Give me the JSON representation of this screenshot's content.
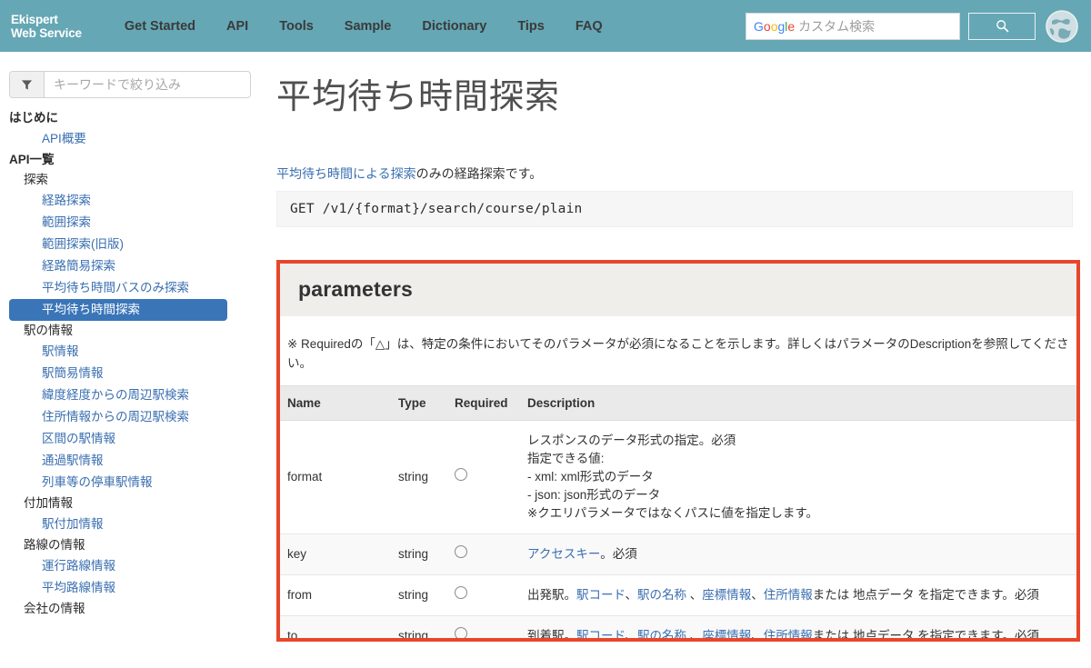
{
  "header": {
    "brand_line1": "Ekispert",
    "brand_line2": "Web Service",
    "nav": [
      {
        "label": "Get Started"
      },
      {
        "label": "API"
      },
      {
        "label": "Tools"
      },
      {
        "label": "Sample"
      },
      {
        "label": "Dictionary"
      },
      {
        "label": "Tips"
      },
      {
        "label": "FAQ"
      }
    ],
    "search": {
      "placeholder_brand": "Google",
      "placeholder_text": " カスタム検索",
      "value": "",
      "button_icon": "search-icon"
    },
    "globe_icon": "globe-icon",
    "background_color": "#65a7b5"
  },
  "sidebar": {
    "filter": {
      "icon": "filter-icon",
      "placeholder": "キーワードで絞り込み",
      "value": ""
    },
    "tree": [
      {
        "type": "h1",
        "label": "はじめに"
      },
      {
        "type": "link",
        "label": "API概要",
        "active": false
      },
      {
        "type": "h1",
        "label": "API一覧"
      },
      {
        "type": "h2",
        "label": "探索"
      },
      {
        "type": "link",
        "label": "経路探索",
        "active": false
      },
      {
        "type": "link",
        "label": "範囲探索",
        "active": false
      },
      {
        "type": "link",
        "label": "範囲探索(旧版)",
        "active": false
      },
      {
        "type": "link",
        "label": "経路簡易探索",
        "active": false
      },
      {
        "type": "link",
        "label": "平均待ち時間バスのみ探索",
        "active": false
      },
      {
        "type": "link",
        "label": "平均待ち時間探索",
        "active": true
      },
      {
        "type": "h2",
        "label": "駅の情報"
      },
      {
        "type": "link",
        "label": "駅情報",
        "active": false
      },
      {
        "type": "link",
        "label": "駅簡易情報",
        "active": false
      },
      {
        "type": "link",
        "label": "緯度経度からの周辺駅検索",
        "active": false
      },
      {
        "type": "link",
        "label": "住所情報からの周辺駅検索",
        "active": false
      },
      {
        "type": "link",
        "label": "区間の駅情報",
        "active": false
      },
      {
        "type": "link",
        "label": "通過駅情報",
        "active": false
      },
      {
        "type": "link",
        "label": "列車等の停車駅情報",
        "active": false
      },
      {
        "type": "h2",
        "label": "付加情報"
      },
      {
        "type": "link",
        "label": "駅付加情報",
        "active": false
      },
      {
        "type": "h2",
        "label": "路線の情報"
      },
      {
        "type": "link",
        "label": "運行路線情報",
        "active": false
      },
      {
        "type": "link",
        "label": "平均路線情報",
        "active": false
      },
      {
        "type": "h2",
        "label": "会社の情報"
      }
    ],
    "active_bg_color": "#3a75b8",
    "link_color": "#3a6fb0"
  },
  "main": {
    "title": "平均待ち時間探索",
    "intro_link": "平均待ち時間による探索",
    "intro_rest": "のみの経路探索です。",
    "endpoint": "GET /v1/{format}/search/course/plain",
    "panel": {
      "heading": "parameters",
      "note": "※ Requiredの「△」は、特定の条件においてそのパラメータが必須になることを示します。詳しくはパラメータのDescriptionを参照してください。",
      "highlight_color": "#e8462a",
      "columns": [
        "Name",
        "Type",
        "Required",
        "Description"
      ],
      "rows": [
        {
          "name": "format",
          "type": "string",
          "required": "○",
          "desc_lines": [
            "レスポンスのデータ形式の指定。必須",
            "指定できる値:",
            "- xml: xml形式のデータ",
            "- json: json形式のデータ",
            "※クエリパラメータではなくパスに値を指定します。"
          ],
          "shaded": false
        },
        {
          "name": "key",
          "type": "string",
          "required": "○",
          "desc_link": "アクセスキー",
          "desc_tail": "。必須",
          "shaded": true
        },
        {
          "name": "from",
          "type": "string",
          "required": "○",
          "desc_prefix": "出発駅。",
          "desc_links": [
            "駅コード",
            "駅の名称",
            "座標情報",
            "住所情報"
          ],
          "desc_mid": "または 地点データ ",
          "desc_tail": "を指定できます。必須",
          "shaded": false
        },
        {
          "name": "to",
          "type": "string",
          "required": "○",
          "desc_prefix": "到着駅。",
          "desc_links": [
            "駅コード",
            "駅の名称",
            "座標情報",
            "住所情報"
          ],
          "desc_mid": "または 地点データ ",
          "desc_tail": "を指定できます。必須",
          "shaded": true
        }
      ]
    }
  }
}
